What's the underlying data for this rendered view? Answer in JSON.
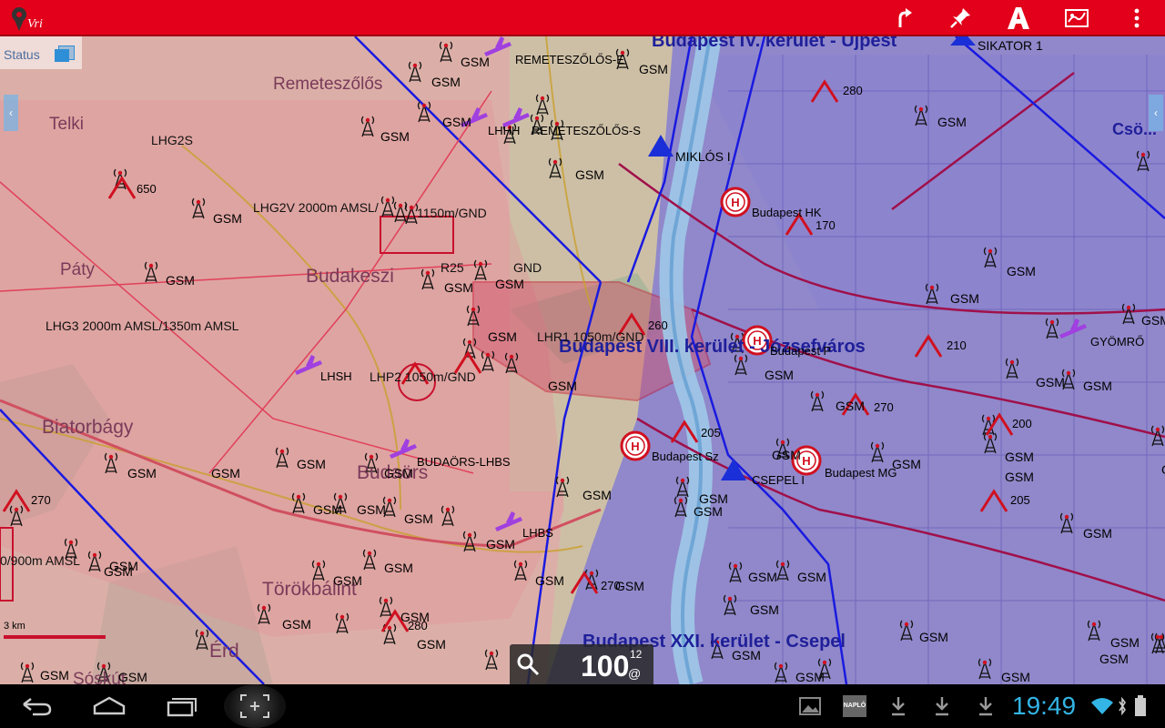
{
  "app": {
    "logo_text": "Vri",
    "status_label": "Status",
    "scale_label": "3 km",
    "zoom_value": "100",
    "zoom_sup": "12",
    "zoom_at": "@"
  },
  "toolbar": {
    "buttons": [
      "route-icon",
      "pin-icon",
      "road-icon",
      "map-icon",
      "overflow-menu-icon"
    ]
  },
  "map": {
    "places": [
      {
        "text": "Remeteszőlős",
        "class": "city"
      },
      {
        "text": "Telki",
        "class": "city"
      },
      {
        "text": "Páty",
        "class": "city"
      },
      {
        "text": "Budakeszi",
        "class": "city-big"
      },
      {
        "text": "Biatorbágy",
        "class": "city-big"
      },
      {
        "text": "Budaörs",
        "class": "city-big"
      },
      {
        "text": "Törökbálint",
        "class": "city-big"
      },
      {
        "text": "Érd",
        "class": "city-big"
      },
      {
        "text": "Sóskút",
        "class": "city"
      }
    ],
    "districts": [
      "Budapest IV. kerület - Újpest",
      "Budapest VIII. kerület - Józsefváros",
      "Budapest XXI. kerület - Csepel",
      "Csö..."
    ],
    "zones": [
      "LHG2S",
      "LHG2V 2000m AMSL/",
      "1150m/GND",
      "LHG3 2000m AMSL/1350m AMSL",
      "LHP2 1050m/GND",
      "LHR1 1050m/GND",
      "R25",
      "GND",
      "0/900m AMSL"
    ],
    "pois": [
      "REMETESZŐLŐS-E",
      "REMETESZŐLŐS-S",
      "LHHH",
      "MIKLÓS I",
      "SIKATOR 1",
      "Budapest HK",
      "BUDAÖRS-LHBS",
      "LHBS",
      "Budapest Sz",
      "CSEPEL I",
      "Budapest MG",
      "GYÖMRŐ",
      "Budapest P",
      "LHSH"
    ],
    "elevations": [
      "280",
      "170",
      "260",
      "210",
      "270",
      "200",
      "205",
      "205",
      "270",
      "280",
      "270",
      "650"
    ],
    "gsm_label": "GSM"
  },
  "navbar": {
    "clock": "19:49",
    "naplo": "NAPLÓ"
  }
}
